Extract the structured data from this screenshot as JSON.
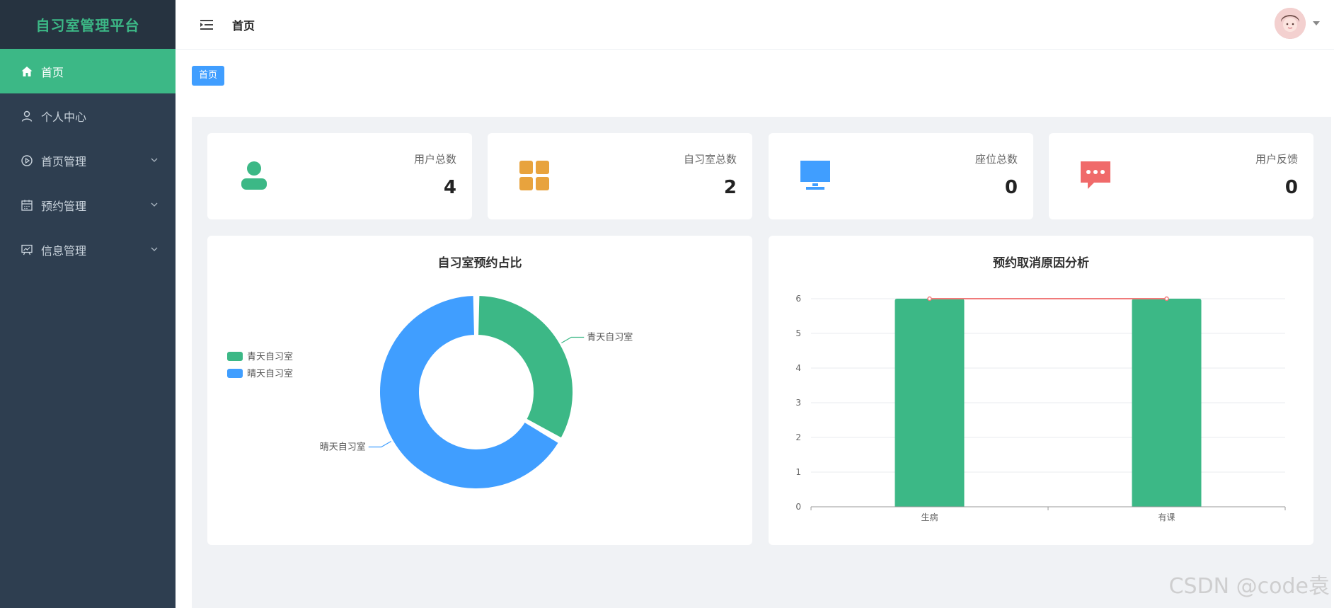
{
  "sidebar": {
    "brand": "自习室管理平台",
    "items": [
      {
        "label": "首页",
        "icon": "home-icon",
        "active": true
      },
      {
        "label": "个人中心",
        "icon": "user-icon"
      },
      {
        "label": "首页管理",
        "icon": "play-circle-icon",
        "expandable": true
      },
      {
        "label": "预约管理",
        "icon": "calendar-icon",
        "expandable": true
      },
      {
        "label": "信息管理",
        "icon": "presentation-chart-icon",
        "expandable": true
      }
    ]
  },
  "header": {
    "title": "首页",
    "menu_icon": "hamburger-icon",
    "avatar_icon": "avatar"
  },
  "breadcrumb": {
    "label": "首页"
  },
  "stats": [
    {
      "label": "用户总数",
      "value": "4",
      "icon": "user-icon",
      "color": "#3cb886"
    },
    {
      "label": "自习室总数",
      "value": "2",
      "icon": "grid-icon",
      "color": "#e8a33d"
    },
    {
      "label": "座位总数",
      "value": "0",
      "icon": "monitor-icon",
      "color": "#409eff"
    },
    {
      "label": "用户反馈",
      "value": "0",
      "icon": "chat-icon",
      "color": "#f06a6a"
    }
  ],
  "colors": {
    "accent": "#3cb886",
    "blue": "#409eff",
    "sidebar": "#2e3e50"
  },
  "chart_data": [
    {
      "type": "pie",
      "title": "自习室预约占比",
      "donut": true,
      "legend": "left",
      "categories": [
        "青天自习室",
        "晴天自习室"
      ],
      "values": [
        1,
        2
      ],
      "colors": [
        "#3cb886",
        "#409eff"
      ]
    },
    {
      "type": "bar",
      "title": "预约取消原因分析",
      "categories": [
        "生病",
        "有课"
      ],
      "values": [
        6,
        6
      ],
      "line_overlay": [
        6,
        6
      ],
      "ylim": [
        0,
        6
      ],
      "yticks": [
        0,
        1,
        2,
        3,
        4,
        5,
        6
      ],
      "grid": true,
      "bar_color": "#3cb886",
      "line_color": "#f07a7a"
    }
  ],
  "watermark": "CSDN @code袁"
}
